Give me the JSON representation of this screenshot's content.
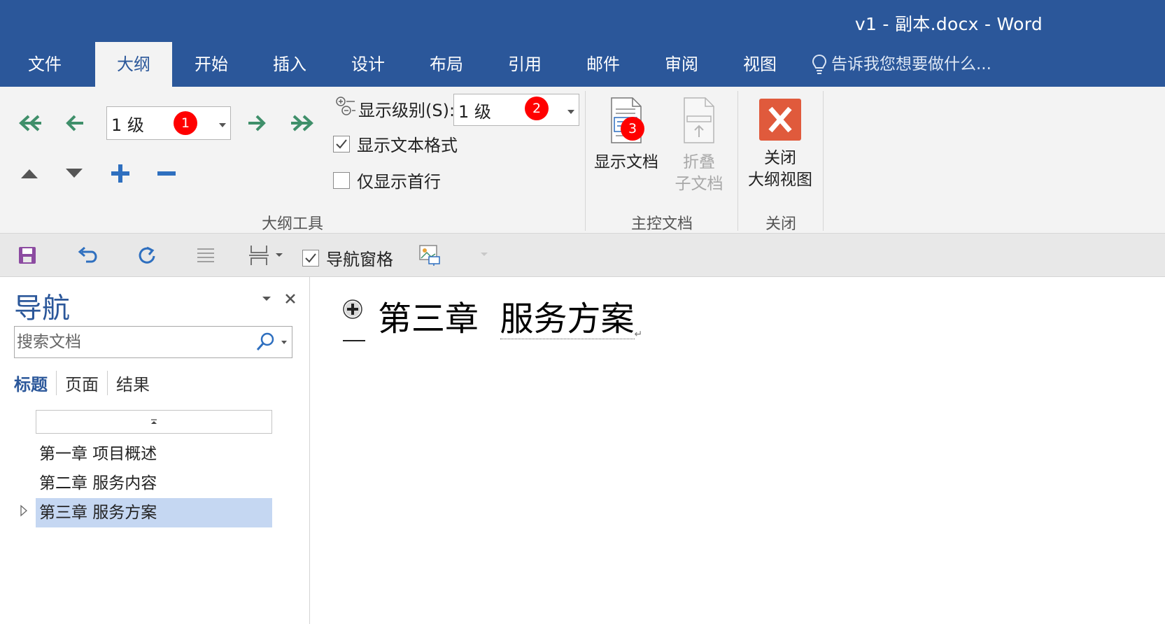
{
  "window": {
    "title": "v1 - 副本.docx - Word"
  },
  "tabs": [
    {
      "label": "文件",
      "active": false
    },
    {
      "label": "大纲",
      "active": true
    },
    {
      "label": "开始",
      "active": false
    },
    {
      "label": "插入",
      "active": false
    },
    {
      "label": "设计",
      "active": false
    },
    {
      "label": "布局",
      "active": false
    },
    {
      "label": "引用",
      "active": false
    },
    {
      "label": "邮件",
      "active": false
    },
    {
      "label": "审阅",
      "active": false
    },
    {
      "label": "视图",
      "active": false
    }
  ],
  "tell_me": {
    "placeholder": "告诉我您想要做什么..."
  },
  "ribbon": {
    "outline_tools": {
      "label": "大纲工具",
      "level_value": "1 级",
      "show_level_label": "显示级别(S):",
      "show_level_value": "1 级",
      "show_text_formatting": {
        "label": "显示文本格式",
        "checked": true
      },
      "show_first_line_only": {
        "label": "仅显示首行",
        "checked": false
      }
    },
    "master_document": {
      "label": "主控文档",
      "show_document_label": "显示文档",
      "collapse_subdocs_line1": "折叠",
      "collapse_subdocs_line2": "子文档"
    },
    "close": {
      "label": "关闭",
      "close_outline_line1": "关闭",
      "close_outline_line2": "大纲视图"
    }
  },
  "badges": {
    "b1": "1",
    "b2": "2",
    "b3": "3"
  },
  "qat": {
    "nav_pane_label": "导航窗格",
    "nav_pane_checked": true
  },
  "nav_pane": {
    "title": "导航",
    "search_placeholder": "搜索文档",
    "tabs": [
      "标题",
      "页面",
      "结果"
    ],
    "headings": [
      {
        "text": "第一章 项目概述",
        "selected": false
      },
      {
        "text": "第二章 服务内容",
        "selected": false
      },
      {
        "text": "第三章 服务方案",
        "selected": true
      }
    ]
  },
  "document": {
    "heading_part1": "第三章",
    "heading_part2": "服务方案"
  },
  "colors": {
    "brand": "#2b579a",
    "ribbon_bg": "#f3f3f3",
    "badge": "#ff0000",
    "close_red": "#e05a3c",
    "outline_green": "#3f8f6a",
    "plus_blue": "#2e6fbf",
    "selected_row": "#c5d7f2"
  }
}
